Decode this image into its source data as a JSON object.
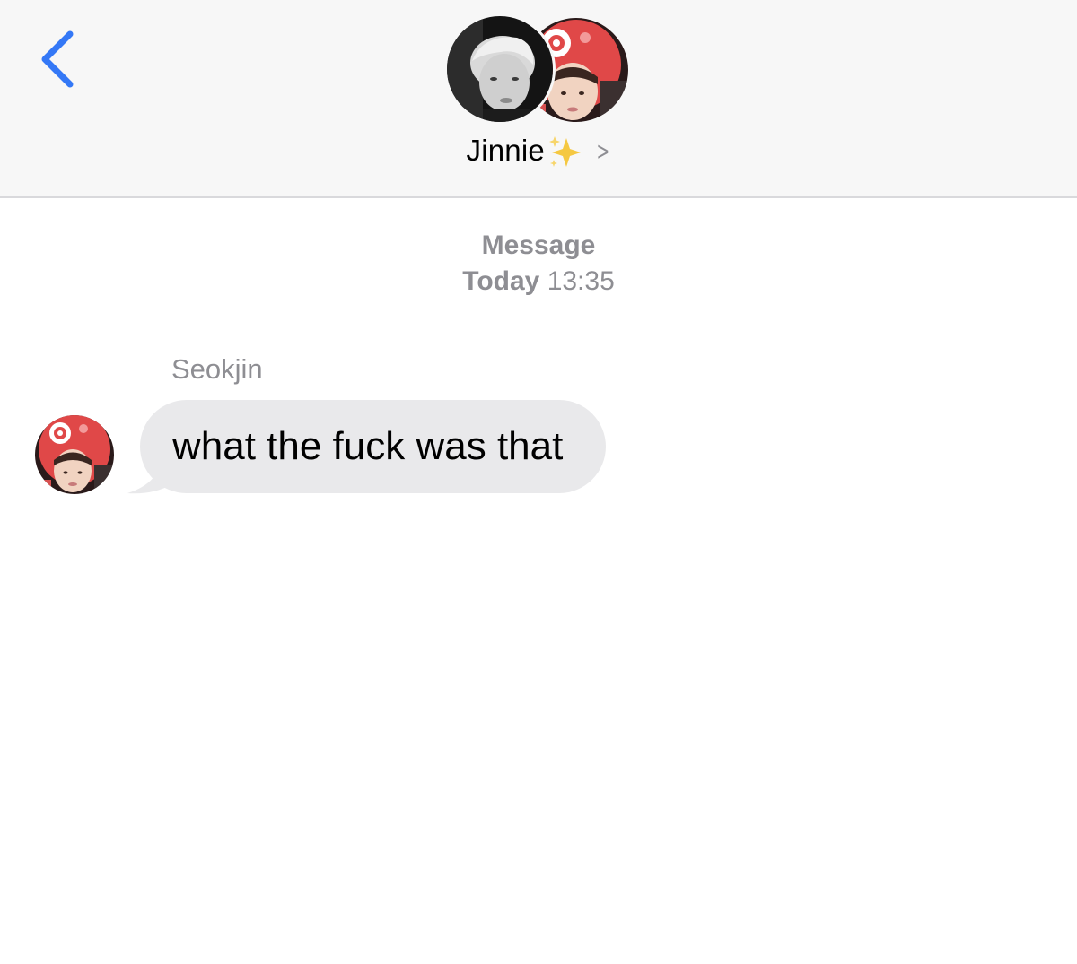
{
  "header": {
    "back_icon": "chevron-left-icon",
    "contact_name": "Jinnie",
    "contact_emoji": "sparkles-icon",
    "chevron_label": ">",
    "accent_color": "#3478f6"
  },
  "conversation": {
    "service_label": "Message",
    "day_label": "Today",
    "time_label": "13:35",
    "sender_name": "Seokjin",
    "messages": [
      {
        "from": "Seokjin",
        "text": "what the fuck was that"
      }
    ],
    "bubble_color": "#e9e9eb"
  }
}
